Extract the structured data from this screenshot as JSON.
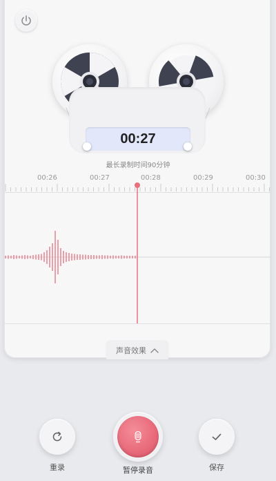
{
  "header": {
    "power_icon": "power-icon"
  },
  "recorder": {
    "elapsed_time": "00:27",
    "max_duration_note": "最长录制时间90分钟",
    "timeline_ticks": [
      "00:26",
      "00:27",
      "00:28",
      "00:29",
      "00:30"
    ]
  },
  "effects": {
    "label": "声音效果",
    "icon": "chevron-up-icon"
  },
  "controls": {
    "rerecord_label": "重录",
    "pause_label": "暂停录音",
    "save_label": "保存"
  },
  "colors": {
    "accent": "#e8697a",
    "playhead": "#e8707c",
    "screen_bg": "#e3e7fa"
  }
}
